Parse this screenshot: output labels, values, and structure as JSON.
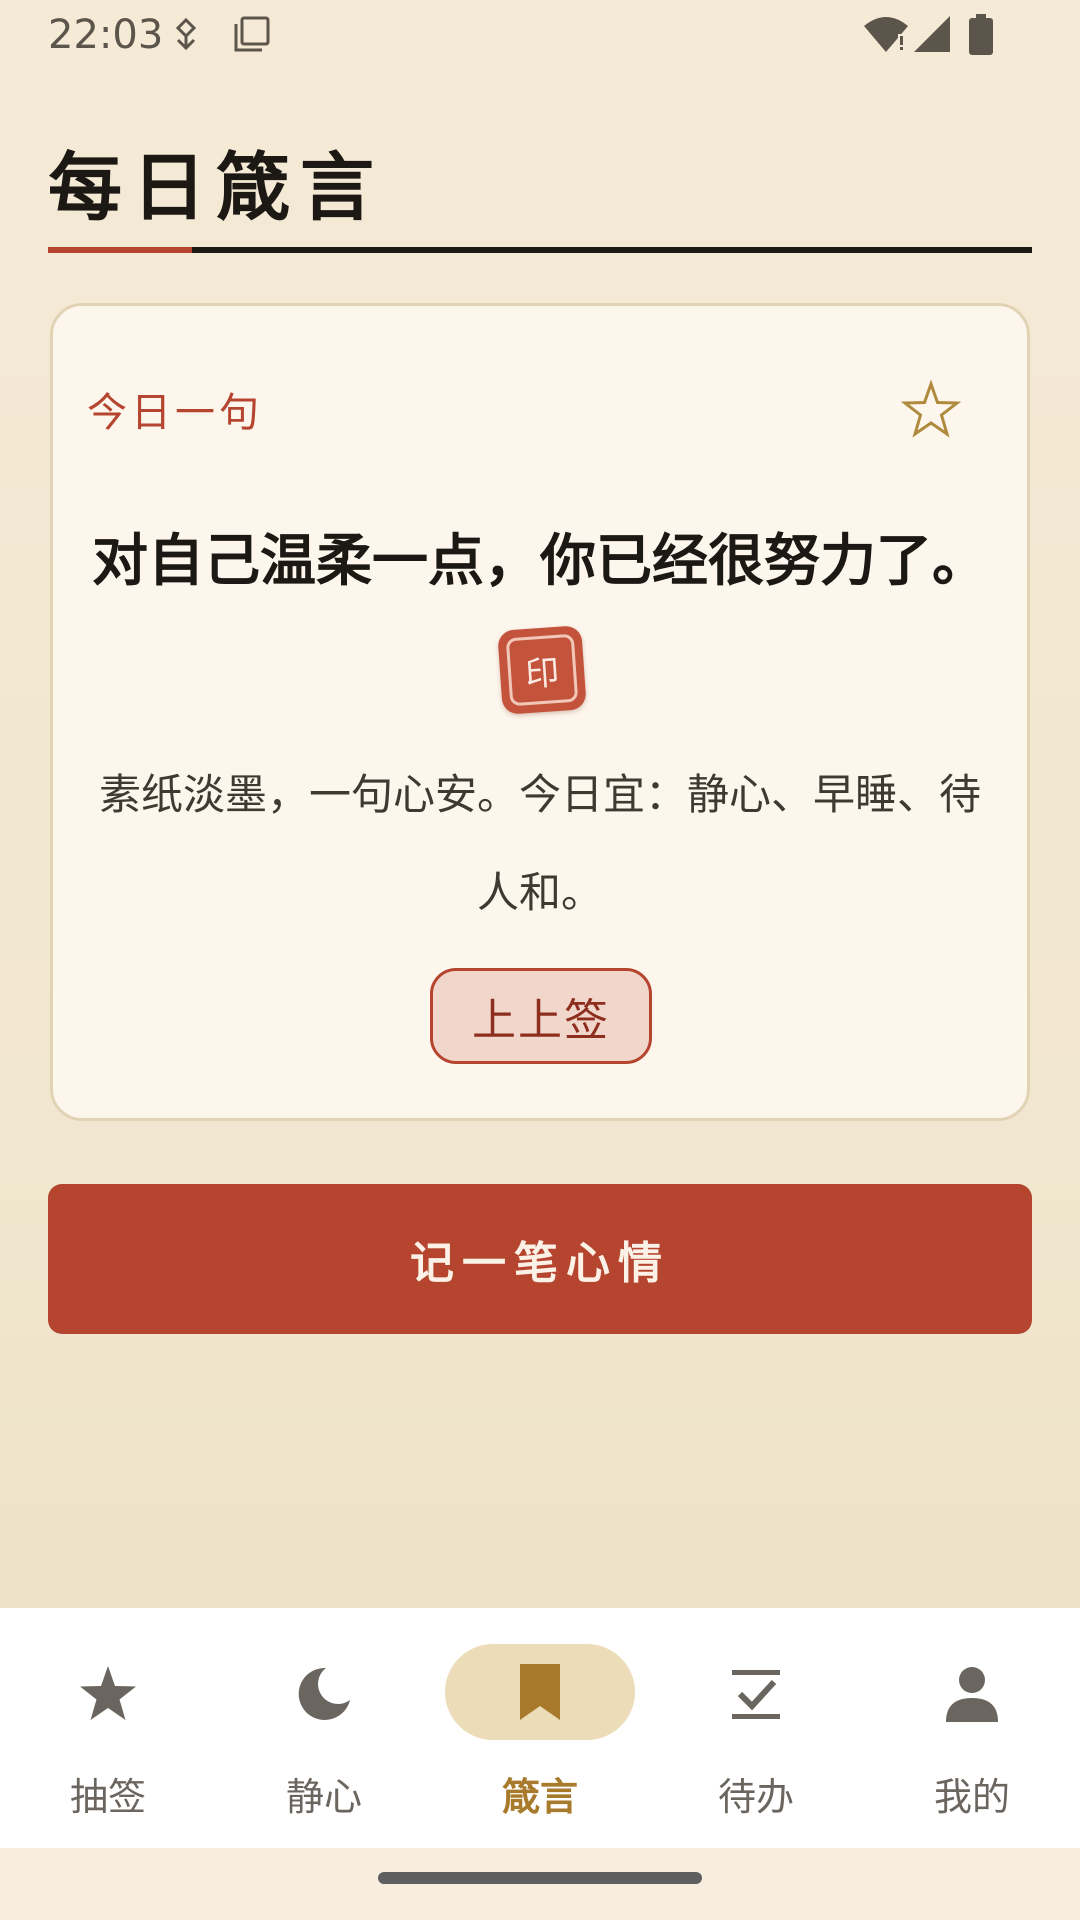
{
  "status_bar": {
    "time": "22:03",
    "icons": [
      "usb-icon",
      "copy-icon",
      "wifi-icon",
      "signal-icon",
      "battery-icon"
    ]
  },
  "header": {
    "title": "每日箴言"
  },
  "card": {
    "label": "今日一句",
    "favorite_icon": "star-outline-icon",
    "quote": "对自己温柔一点，你已经很努力了。",
    "seal_text": "印",
    "description": "素纸淡墨，一句心安。今日宜：静心、早睡、待人和。",
    "fortune": "上上签"
  },
  "primary_button": {
    "label": "记一笔心情"
  },
  "bottom_nav": {
    "items": [
      {
        "label": "抽签",
        "icon": "star-icon"
      },
      {
        "label": "静心",
        "icon": "moon-icon"
      },
      {
        "label": "箴言",
        "icon": "bookmark-icon",
        "active": true
      },
      {
        "label": "待办",
        "icon": "checklist-icon"
      },
      {
        "label": "我的",
        "icon": "person-icon"
      }
    ]
  },
  "colors": {
    "accent": "#b5452f",
    "background": "#f5ead6",
    "card": "#fcf6ec",
    "nav_active": "#a87a2c",
    "nav_active_pill": "#ecdcb8"
  }
}
